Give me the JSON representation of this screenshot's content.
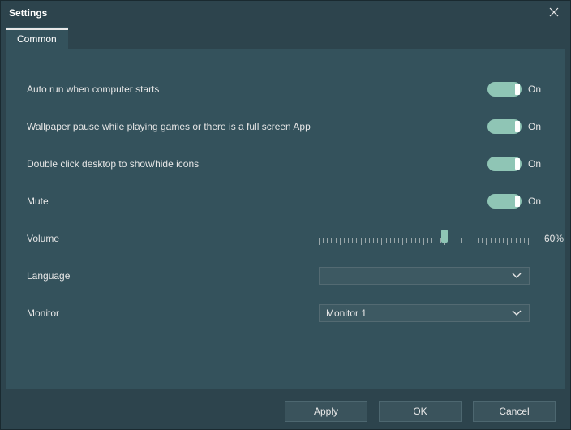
{
  "title": "Settings",
  "tabs": {
    "common": "Common"
  },
  "settings": {
    "autorun": {
      "label": "Auto run when computer starts",
      "state": "On"
    },
    "pause": {
      "label": "Wallpaper pause while playing games or there is a full screen App",
      "state": "On"
    },
    "dblclick": {
      "label": "Double click desktop to show/hide icons",
      "state": "On"
    },
    "mute": {
      "label": "Mute",
      "state": "On"
    },
    "volume": {
      "label": "Volume",
      "value": "60%",
      "percent": 60
    },
    "language": {
      "label": "Language",
      "selected": ""
    },
    "monitor": {
      "label": "Monitor",
      "selected": "Monitor 1"
    }
  },
  "footer": {
    "apply": "Apply",
    "ok": "OK",
    "cancel": "Cancel"
  }
}
